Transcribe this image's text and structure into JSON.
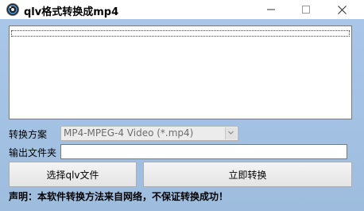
{
  "window": {
    "title": "qlv格式转换成mp4",
    "icon": "app-icon"
  },
  "form": {
    "scheme_label": "转换方案",
    "scheme_value": "MP4-MPEG-4 Video (*.mp4)",
    "output_label": "输出文件夹",
    "output_value": ""
  },
  "buttons": {
    "select_label": "选择qlv文件",
    "convert_label": "立即转换"
  },
  "statement": "声明：本软件转换方法来自网络，不保证转换成功！",
  "colors": {
    "client_background": "#a9c6e8",
    "button_face": "#e4e4e4"
  }
}
